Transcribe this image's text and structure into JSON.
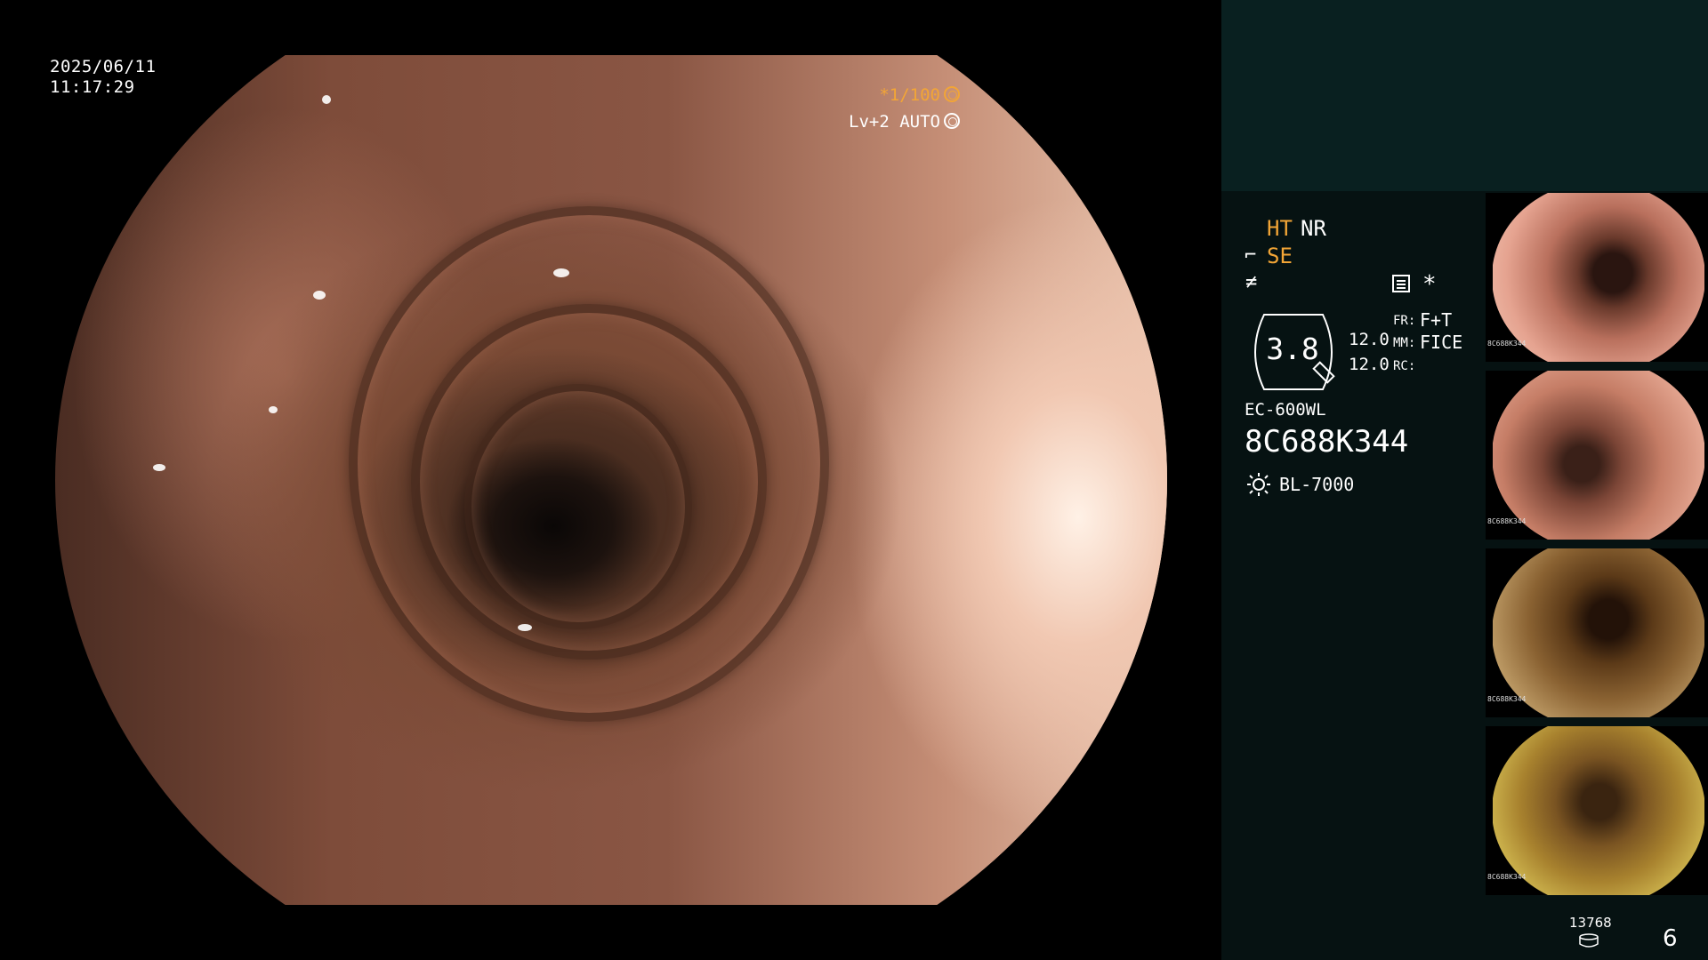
{
  "overlay": {
    "date": "2025/06/11",
    "time": "11:17:29",
    "shutter": "*1/100",
    "level": "Lv+2 AUTO"
  },
  "panel": {
    "ht": "HT",
    "nr": "NR",
    "se": "SE",
    "gauge_value": "3.8",
    "zoom_a": "12.0",
    "zoom_b": "12.0",
    "fr_key": "FR:",
    "fr_val": "F+T",
    "mm_key": "MM:",
    "mm_val": "FICE",
    "rc_key": "RC:",
    "scope_model": "EC-600WL",
    "scope_serial": "8C688K344",
    "light_source": "BL-7000",
    "asterisk": "*"
  },
  "thumbnails": [
    {
      "serial": "8C688K344"
    },
    {
      "serial": "8C688K344"
    },
    {
      "serial": "8C688K344"
    },
    {
      "serial": "8C688K344"
    }
  ],
  "footer": {
    "counter": "13768",
    "page": "6"
  },
  "colors": {
    "accent_orange": "#f2a536",
    "panel_top": "#092020",
    "panel_bottom": "#061212"
  }
}
